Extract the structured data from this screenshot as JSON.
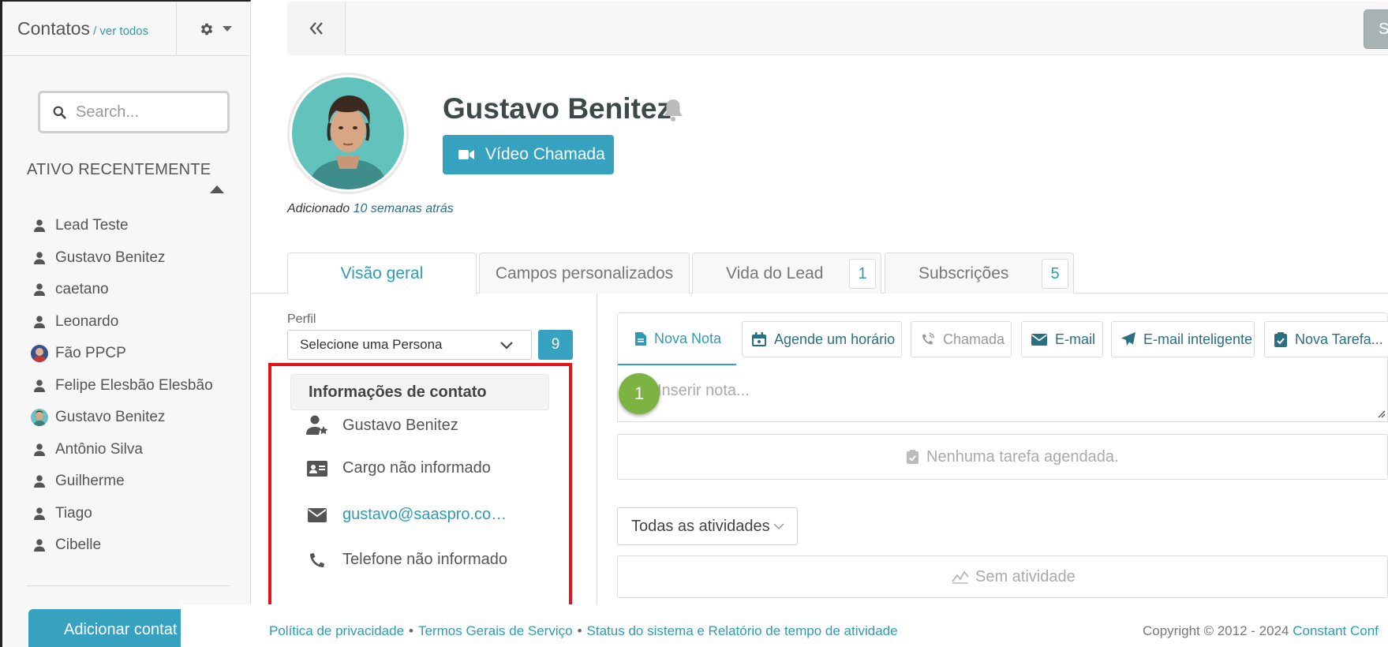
{
  "sidebar": {
    "title": "Contatos",
    "view_all": "/ ver todos",
    "search_placeholder": "Search...",
    "recent_title": "ATIVO RECENTEMENTE",
    "items": [
      {
        "label": "Lead Teste",
        "icon": "user-icon"
      },
      {
        "label": "Gustavo Benitez",
        "icon": "user-icon"
      },
      {
        "label": "caetano",
        "icon": "user-icon"
      },
      {
        "label": "Leonardo",
        "icon": "user-icon"
      },
      {
        "label": "Fão PPCP",
        "icon": "avatar"
      },
      {
        "label": "Felipe Elesbão Elesbão",
        "icon": "user-icon"
      },
      {
        "label": "Gustavo Benitez",
        "icon": "avatar"
      },
      {
        "label": "Antônio Silva",
        "icon": "user-icon"
      },
      {
        "label": "Guilherme",
        "icon": "user-icon"
      },
      {
        "label": "Tiago",
        "icon": "user-icon"
      },
      {
        "label": "Cibelle",
        "icon": "user-icon"
      }
    ],
    "add_button": "Adicionar contat"
  },
  "toolbar": {
    "save_label": "Salvar"
  },
  "profile": {
    "name": "Gustavo Benitez",
    "video_call": "Vídeo Chamada",
    "added_prefix": "Adicionado",
    "added_when": "10 semanas atrás"
  },
  "tabs": [
    {
      "label": "Visão geral"
    },
    {
      "label": "Campos personalizados"
    },
    {
      "label": "Vida do Lead",
      "badge": "1"
    },
    {
      "label": "Subscrições",
      "badge": "5"
    }
  ],
  "perfil": {
    "label": "Perfil",
    "select_value": "Selecione uma Persona",
    "count": "9"
  },
  "contact_info": {
    "header": "Informações de contato",
    "name": "Gustavo Benitez",
    "position": "Cargo não informado",
    "email": "gustavo@saaspro.co…",
    "phone": "Telefone não informado"
  },
  "activity": {
    "tabs": [
      {
        "label": "Nova Nota",
        "icon": "file-icon"
      },
      {
        "label": "Agende um horário",
        "icon": "calendar-icon"
      },
      {
        "label": "Chamada",
        "icon": "phone-call-icon"
      },
      {
        "label": "E-mail",
        "icon": "envelope-icon"
      },
      {
        "label": "E-mail inteligente",
        "icon": "paper-plane-icon"
      },
      {
        "label": "Nova Tarefa...",
        "icon": "clipboard-check-icon"
      }
    ],
    "note_placeholder": "Inserir nota...",
    "step_badge": "1",
    "no_task": "Nenhuma tarefa agendada.",
    "filter": "Todas as atividades",
    "no_activity": "Sem atividade"
  },
  "footer": {
    "privacy": "Política de privacidade",
    "terms": "Termos Gerais de Serviço",
    "status": "Status do sistema e Relatório de tempo de atividade",
    "bullet": "•",
    "copyright": "Copyright © 2012 - 2024",
    "brand": "Constant Conf"
  },
  "colors": {
    "accent": "#37a2bf",
    "link": "#2e9bb5",
    "highlight_box": "#e3151b",
    "step_badge": "#7cb342"
  }
}
